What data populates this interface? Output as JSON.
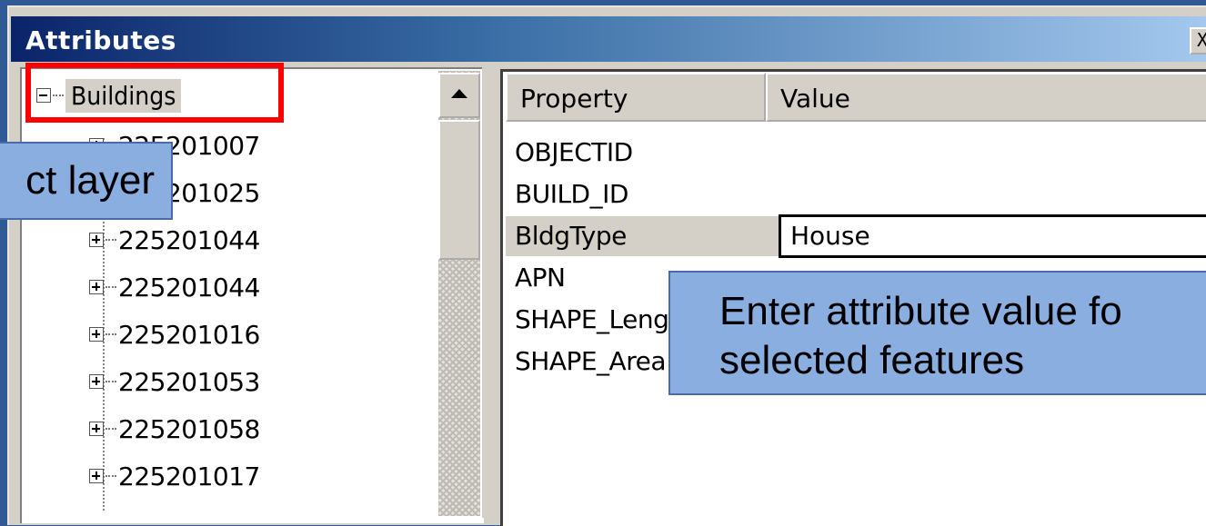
{
  "window": {
    "title": "Attributes",
    "close_glyph": "X"
  },
  "tree": {
    "root_label": "Buildings",
    "items": [
      {
        "label": "225201007"
      },
      {
        "label": "225201025"
      },
      {
        "label": "225201044"
      },
      {
        "label": "225201044"
      },
      {
        "label": "225201016"
      },
      {
        "label": "225201053"
      },
      {
        "label": "225201058"
      },
      {
        "label": "225201017"
      }
    ]
  },
  "grid": {
    "headers": {
      "property": "Property",
      "value": "Value"
    },
    "rows": [
      {
        "name": "OBJECTID",
        "value": ""
      },
      {
        "name": "BUILD_ID",
        "value": ""
      },
      {
        "name": "BldgType",
        "value": "House"
      },
      {
        "name": "APN",
        "value": ""
      },
      {
        "name": "SHAPE_Length",
        "value": ""
      },
      {
        "name": "SHAPE_Area",
        "value": ""
      }
    ]
  },
  "callouts": {
    "left": "ct layer",
    "right_line1": "Enter attribute value fo",
    "right_line2": "selected features"
  },
  "colors": {
    "highlight_box": "#ff0000",
    "callout_fill": "#8aaee0",
    "title_bar_start": "#0a246a",
    "title_bar_end": "#a6caf0"
  }
}
